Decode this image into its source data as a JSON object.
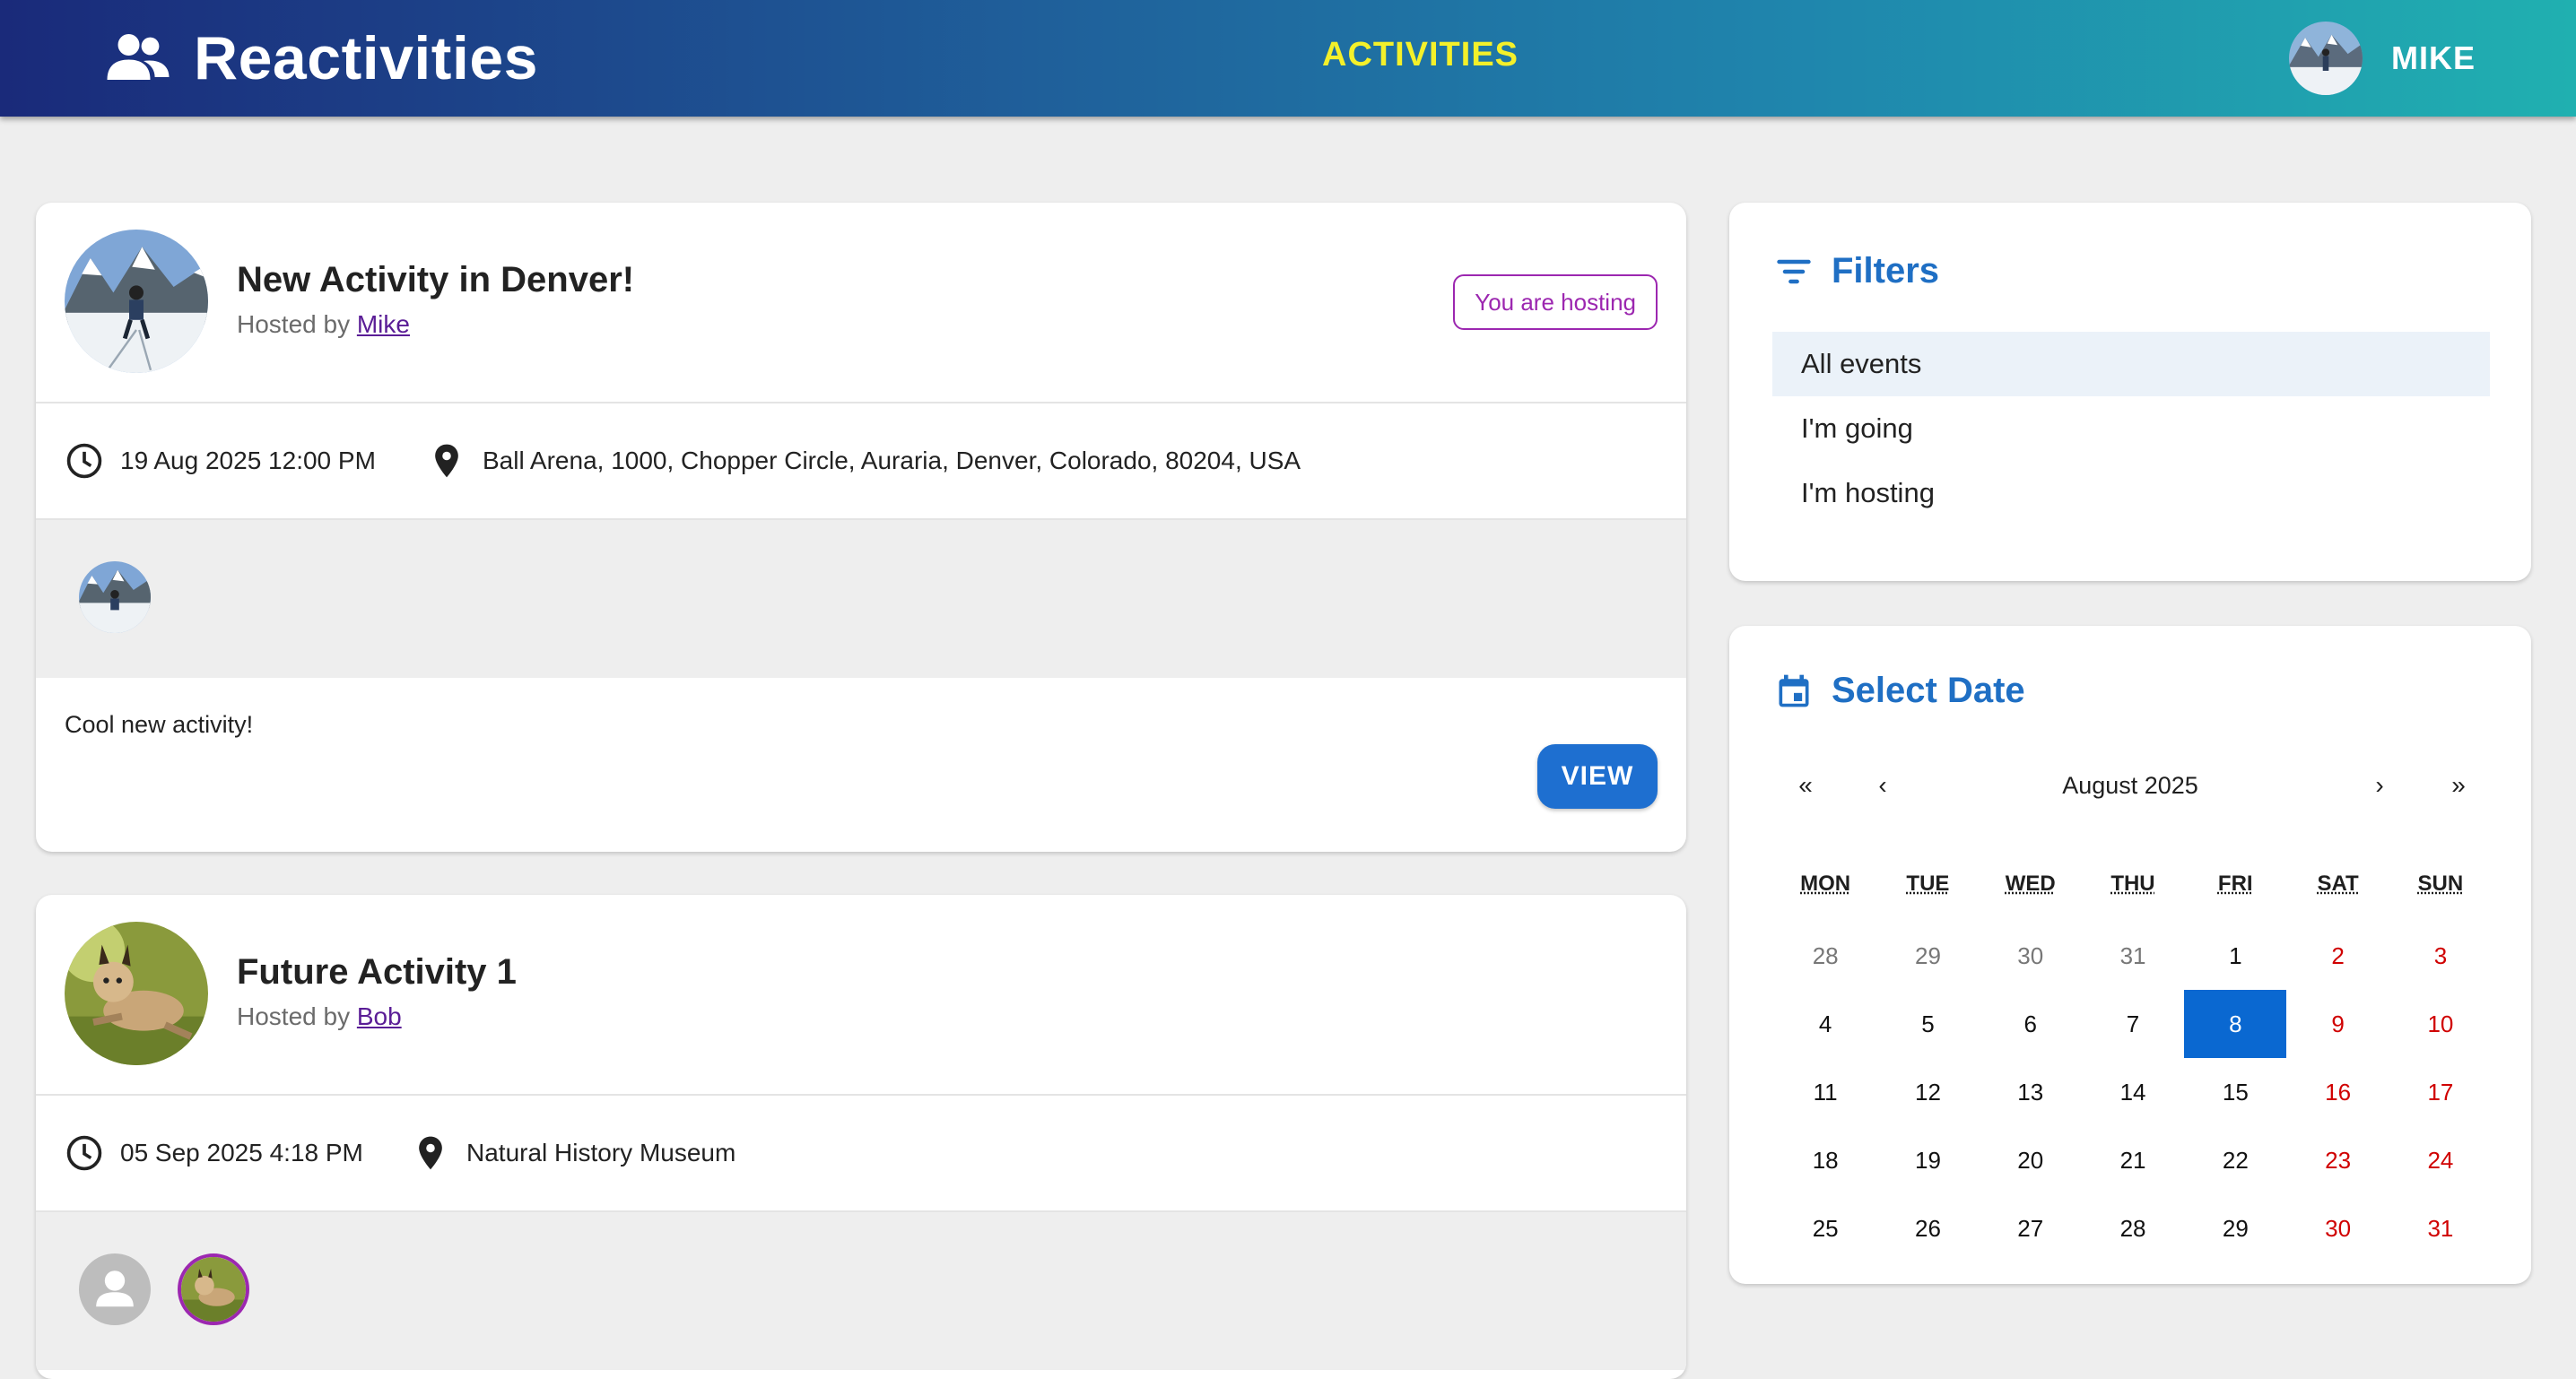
{
  "appbar": {
    "title": "Reactivities",
    "nav_activities": "ACTIVITIES",
    "user_name": "MIKE"
  },
  "activities": [
    {
      "title": "New Activity in Denver!",
      "hosted_prefix": "Hosted by",
      "host": "Mike",
      "hosting_label": "You are hosting",
      "datetime": "19 Aug 2025 12:00 PM",
      "venue": "Ball Arena, 1000, Chopper Circle, Auraria, Denver, Colorado, 80204, USA",
      "description": "Cool new activity!",
      "view_label": "VIEW"
    },
    {
      "title": "Future Activity 1",
      "hosted_prefix": "Hosted by",
      "host": "Bob",
      "datetime": "05 Sep 2025 4:18 PM",
      "venue": "Natural History Museum"
    }
  ],
  "filters": {
    "title": "Filters",
    "items": [
      "All events",
      "I'm going",
      "I'm hosting"
    ],
    "active": "All events"
  },
  "calendar": {
    "title": "Select Date",
    "prev2": "«",
    "prev": "‹",
    "month": "August 2025",
    "next": "›",
    "next2": "»",
    "weekdays": [
      "MON",
      "TUE",
      "WED",
      "THU",
      "FRI",
      "SAT",
      "SUN"
    ],
    "days": [
      "28",
      "29",
      "30",
      "31",
      "1",
      "2",
      "3",
      "4",
      "5",
      "6",
      "7",
      "8",
      "9",
      "10",
      "11",
      "12",
      "13",
      "14",
      "15",
      "16",
      "17",
      "18",
      "19",
      "20",
      "21",
      "22",
      "23",
      "24",
      "25",
      "26",
      "27",
      "28",
      "29",
      "30",
      "31"
    ],
    "selected_day": "8"
  },
  "colors": {
    "accent": "#1f6fc4",
    "nav_active": "#f4f02a",
    "hosting": "#9c27b0",
    "view_button": "#1e6fd0",
    "weekend": "#d00000",
    "selected": "#0a68d1"
  },
  "icons": [
    "people-icon",
    "clock-icon",
    "location-pin-icon",
    "filter-icon",
    "calendar-icon",
    "person-icon"
  ]
}
